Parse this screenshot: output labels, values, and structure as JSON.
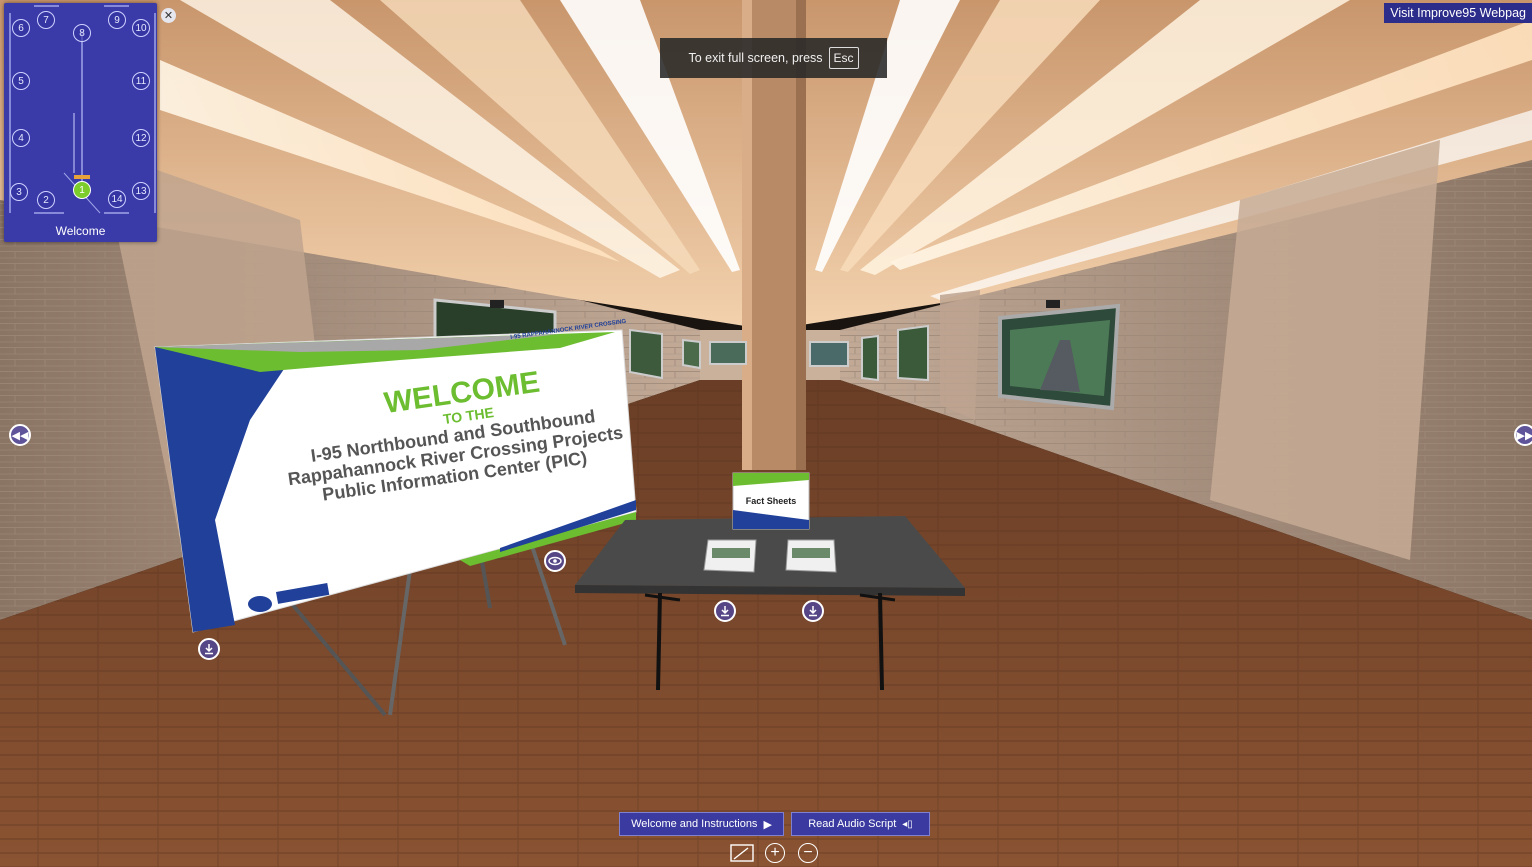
{
  "minimap": {
    "label": "Welcome",
    "nodes": [
      "1",
      "2",
      "3",
      "4",
      "5",
      "6",
      "7",
      "8",
      "9",
      "10",
      "11",
      "12",
      "13",
      "14"
    ],
    "active": "1"
  },
  "toast": {
    "text": "To exit full screen, press",
    "key": "Esc"
  },
  "header": {
    "visit_link": "Visit Improve95 Webpag"
  },
  "poster": {
    "header_small": "I-95 RAPPAHANNOCK RIVER CROSSING",
    "welcome": "WELCOME",
    "to_the": "TO THE",
    "line1": "I-95 Northbound and Southbound",
    "line2": "Rappahannock River Crossing Projects",
    "line3": "Public Information Center (PIC)"
  },
  "table_sign": "Fact Sheets",
  "bottom": {
    "welcome_btn": "Welcome and Instructions",
    "audio_btn": "Read Audio Script"
  },
  "colors": {
    "panel": "#3a3aa8",
    "accent_green": "#7ccc2c",
    "brand_blue": "#1f3a9c"
  }
}
